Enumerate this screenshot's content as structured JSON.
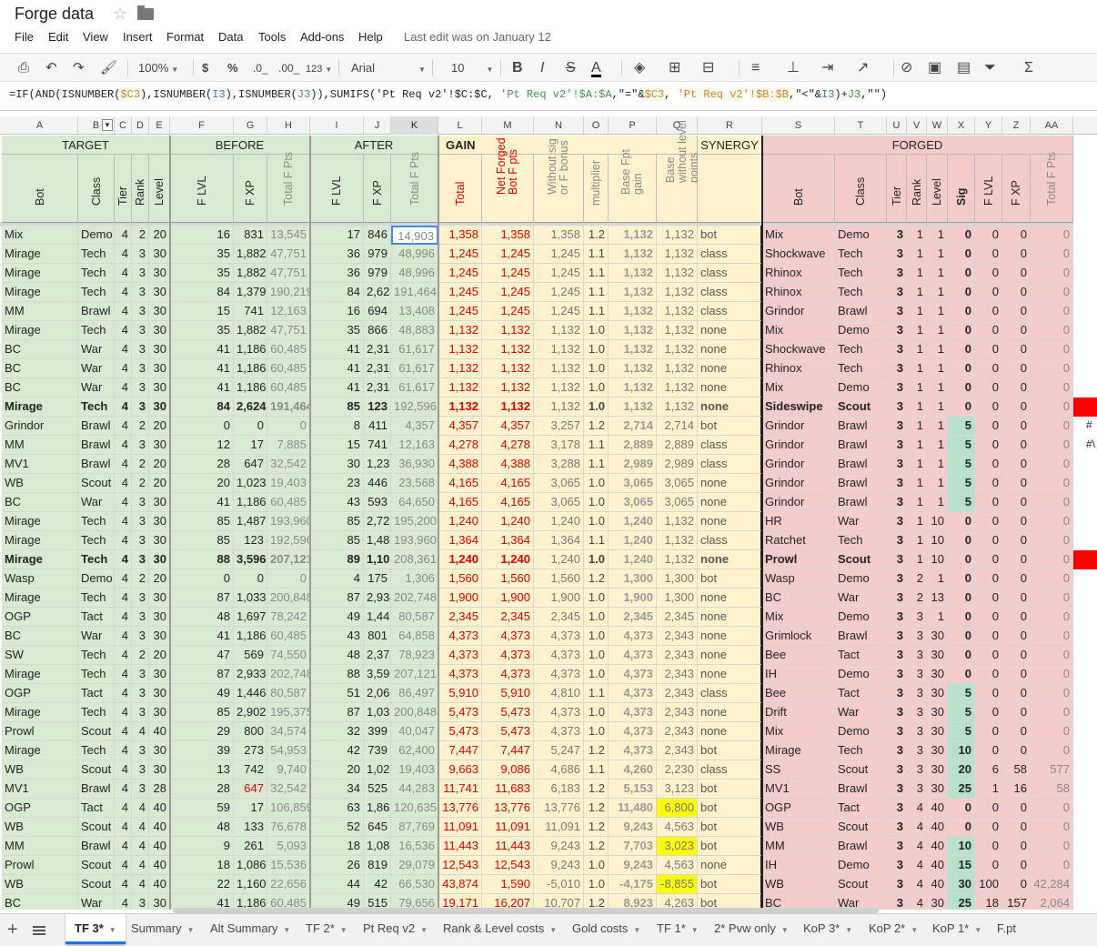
{
  "title": "Forge data",
  "menu": [
    "File",
    "Edit",
    "View",
    "Insert",
    "Format",
    "Data",
    "Tools",
    "Add-ons",
    "Help"
  ],
  "last_edit": "Last edit was on January 12",
  "toolbar": {
    "zoom": "100%",
    "currency": "$",
    "percent": "%",
    "dec_less": ".0_",
    "dec_more": ".00_",
    "format_num": "123",
    "font": "Arial",
    "size": "10"
  },
  "formula_parts": [
    {
      "t": "=IF(AND(ISNUMBER(",
      "c": ""
    },
    {
      "t": "$C3",
      "c": "f-ref1"
    },
    {
      "t": "),ISNUMBER(",
      "c": ""
    },
    {
      "t": "I3",
      "c": "f-ref2"
    },
    {
      "t": "),ISNUMBER(",
      "c": ""
    },
    {
      "t": "J3",
      "c": "f-ref3"
    },
    {
      "t": ")),SUMIFS('Pt Req v2'!$C:$C, ",
      "c": ""
    },
    {
      "t": "'Pt Req v2'!$A:$A",
      "c": "f-ref3"
    },
    {
      "t": ",\"=\"&",
      "c": ""
    },
    {
      "t": "$C3",
      "c": "f-ref1"
    },
    {
      "t": ", ",
      "c": ""
    },
    {
      "t": "'Pt Req v2'!$B:$B",
      "c": "f-num"
    },
    {
      "t": ",\"<\"&",
      "c": ""
    },
    {
      "t": "I3",
      "c": "f-ref2"
    },
    {
      "t": ")+",
      "c": ""
    },
    {
      "t": "J3",
      "c": "f-ref3"
    },
    {
      "t": ",\"\")",
      "c": ""
    }
  ],
  "columns": [
    "A",
    "B",
    "C",
    "D",
    "E",
    "F",
    "G",
    "H",
    "I",
    "J",
    "K",
    "L",
    "M",
    "N",
    "O",
    "P",
    "Q",
    "R",
    "S",
    "T",
    "U",
    "V",
    "W",
    "X",
    "Y",
    "Z",
    "AA"
  ],
  "bands": {
    "target": "TARGET",
    "before": "BEFORE",
    "after": "AFTER",
    "gain": "GAIN",
    "synergy": "SYNERGY",
    "forged": "FORGED"
  },
  "subheaders": [
    "Bot",
    "Class",
    "Tier",
    "Rank",
    "Level",
    "F LVL",
    "F XP",
    "Total F Pts",
    "F LVL",
    "F XP",
    "Total F Pts",
    "Total",
    "Net Forged Bot F pts",
    "Without sig or F bonus",
    "multiplier",
    "Base Fpt gain",
    "Base without level points",
    "",
    "Bot",
    "Class",
    "Tier",
    "Rank",
    "Level",
    "Sig",
    "F LVL",
    "F XP",
    "Total F Pts"
  ],
  "rows": [
    [
      "Mix",
      "Demo",
      "4",
      "2",
      "20",
      "16",
      "831",
      "13,545",
      "17",
      "846",
      "14,903",
      "1,358",
      "1,358",
      "1,358",
      "1.2",
      "1,132",
      "1,132",
      "bot",
      "Mix",
      "Demo",
      "3",
      "1",
      "1",
      "0",
      "0",
      "0",
      "0"
    ],
    [
      "Mirage",
      "Tech",
      "4",
      "3",
      "30",
      "35",
      "1,882",
      "47,751",
      "36",
      "979",
      "48,996",
      "1,245",
      "1,245",
      "1,245",
      "1.1",
      "1,132",
      "1,132",
      "class",
      "Shockwave",
      "Tech",
      "3",
      "1",
      "1",
      "0",
      "0",
      "0",
      "0"
    ],
    [
      "Mirage",
      "Tech",
      "4",
      "3",
      "30",
      "35",
      "1,882",
      "47,751",
      "36",
      "979",
      "48,996",
      "1,245",
      "1,245",
      "1,245",
      "1.1",
      "1,132",
      "1,132",
      "class",
      "Rhinox",
      "Tech",
      "3",
      "1",
      "1",
      "0",
      "0",
      "0",
      "0"
    ],
    [
      "Mirage",
      "Tech",
      "4",
      "3",
      "30",
      "84",
      "1,379",
      "190,219",
      "84",
      "2,624",
      "191,464",
      "1,245",
      "1,245",
      "1,245",
      "1.1",
      "1,132",
      "1,132",
      "class",
      "Rhinox",
      "Tech",
      "3",
      "1",
      "1",
      "0",
      "0",
      "0",
      "0"
    ],
    [
      "MM",
      "Brawl",
      "4",
      "3",
      "30",
      "15",
      "741",
      "12,163",
      "16",
      "694",
      "13,408",
      "1,245",
      "1,245",
      "1,245",
      "1.1",
      "1,132",
      "1,132",
      "class",
      "Grindor",
      "Brawl",
      "3",
      "1",
      "1",
      "0",
      "0",
      "0",
      "0"
    ],
    [
      "Mirage",
      "Tech",
      "4",
      "3",
      "30",
      "35",
      "1,882",
      "47,751",
      "35",
      "866",
      "48,883",
      "1,132",
      "1,132",
      "1,132",
      "1.0",
      "1,132",
      "1,132",
      "none",
      "Mix",
      "Demo",
      "3",
      "1",
      "1",
      "0",
      "0",
      "0",
      "0"
    ],
    [
      "BC",
      "War",
      "4",
      "3",
      "30",
      "41",
      "1,186",
      "60,485",
      "41",
      "2,318",
      "61,617",
      "1,132",
      "1,132",
      "1,132",
      "1.0",
      "1,132",
      "1,132",
      "none",
      "Shockwave",
      "Tech",
      "3",
      "1",
      "1",
      "0",
      "0",
      "0",
      "0"
    ],
    [
      "BC",
      "War",
      "4",
      "3",
      "30",
      "41",
      "1,186",
      "60,485",
      "41",
      "2,318",
      "61,617",
      "1,132",
      "1,132",
      "1,132",
      "1.0",
      "1,132",
      "1,132",
      "none",
      "Rhinox",
      "Tech",
      "3",
      "1",
      "1",
      "0",
      "0",
      "0",
      "0"
    ],
    [
      "BC",
      "War",
      "4",
      "3",
      "30",
      "41",
      "1,186",
      "60,485",
      "41",
      "2,318",
      "61,617",
      "1,132",
      "1,132",
      "1,132",
      "1.0",
      "1,132",
      "1,132",
      "none",
      "Mix",
      "Demo",
      "3",
      "1",
      "1",
      "0",
      "0",
      "0",
      "0"
    ],
    [
      "Mirage",
      "Tech",
      "4",
      "3",
      "30",
      "84",
      "2,624",
      "191,464",
      "85",
      "123",
      "192,596",
      "1,132",
      "1,132",
      "1,132",
      "1.0",
      "1,132",
      "1,132",
      "none",
      "Sideswipe",
      "Scout",
      "3",
      "1",
      "1",
      "0",
      "0",
      "0",
      "0"
    ],
    [
      "Grindor",
      "Brawl",
      "4",
      "2",
      "20",
      "0",
      "0",
      "0",
      "8",
      "411",
      "4,357",
      "4,357",
      "4,357",
      "3,257",
      "1.2",
      "2,714",
      "2,714",
      "bot",
      "Grindor",
      "Brawl",
      "3",
      "1",
      "1",
      "5",
      "0",
      "0",
      "0"
    ],
    [
      "MM",
      "Brawl",
      "4",
      "3",
      "30",
      "12",
      "17",
      "7,885",
      "15",
      "741",
      "12,163",
      "4,278",
      "4,278",
      "3,178",
      "1.1",
      "2,889",
      "2,889",
      "class",
      "Grindor",
      "Brawl",
      "3",
      "1",
      "1",
      "5",
      "0",
      "0",
      "0"
    ],
    [
      "MV1",
      "Brawl",
      "4",
      "2",
      "20",
      "28",
      "647",
      "32,542",
      "30",
      "1,237",
      "36,930",
      "4,388",
      "4,388",
      "3,288",
      "1.1",
      "2,989",
      "2,989",
      "class",
      "Grindor",
      "Brawl",
      "3",
      "1",
      "1",
      "5",
      "0",
      "0",
      "0"
    ],
    [
      "WB",
      "Scout",
      "4",
      "2",
      "20",
      "20",
      "1,023",
      "19,403",
      "23",
      "446",
      "23,568",
      "4,165",
      "4,165",
      "3,065",
      "1.0",
      "3,065",
      "3,065",
      "none",
      "Grindor",
      "Brawl",
      "3",
      "1",
      "1",
      "5",
      "0",
      "0",
      "0"
    ],
    [
      "BC",
      "War",
      "4",
      "3",
      "30",
      "41",
      "1,186",
      "60,485",
      "43",
      "593",
      "64,650",
      "4,165",
      "4,165",
      "3,065",
      "1.0",
      "3,065",
      "3,065",
      "none",
      "Grindor",
      "Brawl",
      "3",
      "1",
      "1",
      "5",
      "0",
      "0",
      "0"
    ],
    [
      "Mirage",
      "Tech",
      "4",
      "3",
      "30",
      "85",
      "1,487",
      "193,960",
      "85",
      "2,727",
      "195,200",
      "1,240",
      "1,240",
      "1,240",
      "1.0",
      "1,240",
      "1,132",
      "none",
      "HR",
      "War",
      "3",
      "1",
      "10",
      "0",
      "0",
      "0",
      "0"
    ],
    [
      "Mirage",
      "Tech",
      "4",
      "3",
      "30",
      "85",
      "123",
      "192,596",
      "85",
      "1,487",
      "193,960",
      "1,364",
      "1,364",
      "1,364",
      "1.1",
      "1,240",
      "1,132",
      "class",
      "Ratchet",
      "Tech",
      "3",
      "1",
      "10",
      "0",
      "0",
      "0",
      "0"
    ],
    [
      "Mirage",
      "Tech",
      "4",
      "3",
      "30",
      "88",
      "3,596",
      "207,121",
      "89",
      "1,101",
      "208,361",
      "1,240",
      "1,240",
      "1,240",
      "1.0",
      "1,240",
      "1,132",
      "none",
      "Prowl",
      "Scout",
      "3",
      "1",
      "10",
      "0",
      "0",
      "0",
      "0"
    ],
    [
      "Wasp",
      "Demo",
      "4",
      "2",
      "20",
      "0",
      "0",
      "0",
      "4",
      "175",
      "1,306",
      "1,560",
      "1,560",
      "1,560",
      "1.2",
      "1,300",
      "1,300",
      "bot",
      "Wasp",
      "Demo",
      "3",
      "2",
      "1",
      "0",
      "0",
      "0",
      "0"
    ],
    [
      "Mirage",
      "Tech",
      "4",
      "3",
      "30",
      "87",
      "1,033",
      "200,848",
      "87",
      "2,933",
      "202,748",
      "1,900",
      "1,900",
      "1,900",
      "1.0",
      "1,900",
      "1,300",
      "none",
      "BC",
      "War",
      "3",
      "2",
      "13",
      "0",
      "0",
      "0",
      "0"
    ],
    [
      "OGP",
      "Tact",
      "4",
      "3",
      "30",
      "48",
      "1,697",
      "78,242",
      "49",
      "1,446",
      "80,587",
      "2,345",
      "2,345",
      "2,345",
      "1.0",
      "2,345",
      "2,345",
      "none",
      "Mix",
      "Demo",
      "3",
      "3",
      "1",
      "0",
      "0",
      "0",
      "0"
    ],
    [
      "BC",
      "War",
      "4",
      "3",
      "30",
      "41",
      "1,186",
      "60,485",
      "43",
      "801",
      "64,858",
      "4,373",
      "4,373",
      "4,373",
      "1.0",
      "4,373",
      "2,343",
      "none",
      "Grimlock",
      "Brawl",
      "3",
      "3",
      "30",
      "0",
      "0",
      "0",
      "0"
    ],
    [
      "SW",
      "Tech",
      "4",
      "2",
      "20",
      "47",
      "569",
      "74,550",
      "48",
      "2,378",
      "78,923",
      "4,373",
      "4,373",
      "4,373",
      "1.0",
      "4,373",
      "2,343",
      "none",
      "Bee",
      "Tact",
      "3",
      "3",
      "30",
      "0",
      "0",
      "0",
      "0"
    ],
    [
      "Mirage",
      "Tech",
      "4",
      "3",
      "30",
      "87",
      "2,933",
      "202,748",
      "88",
      "3,596",
      "207,121",
      "4,373",
      "4,373",
      "4,373",
      "1.0",
      "4,373",
      "2,343",
      "none",
      "IH",
      "Demo",
      "3",
      "3",
      "30",
      "0",
      "0",
      "0",
      "0"
    ],
    [
      "OGP",
      "Tact",
      "4",
      "3",
      "30",
      "49",
      "1,446",
      "80,587",
      "51",
      "2,066",
      "86,497",
      "5,910",
      "5,910",
      "4,810",
      "1.1",
      "4,373",
      "2,343",
      "class",
      "Bee",
      "Tact",
      "3",
      "3",
      "30",
      "5",
      "0",
      "0",
      "0"
    ],
    [
      "Mirage",
      "Tech",
      "4",
      "3",
      "30",
      "85",
      "2,902",
      "195,375",
      "87",
      "1,033",
      "200,848",
      "5,473",
      "5,473",
      "4,373",
      "1.0",
      "4,373",
      "2,343",
      "none",
      "Drift",
      "War",
      "3",
      "3",
      "30",
      "5",
      "0",
      "0",
      "0"
    ],
    [
      "Prowl",
      "Scout",
      "4",
      "4",
      "40",
      "29",
      "800",
      "34,574",
      "32",
      "399",
      "40,047",
      "5,473",
      "5,473",
      "4,373",
      "1.0",
      "4,373",
      "2,343",
      "none",
      "Mix",
      "Demo",
      "3",
      "3",
      "30",
      "5",
      "0",
      "0",
      "0"
    ],
    [
      "Mirage",
      "Tech",
      "4",
      "3",
      "30",
      "39",
      "273",
      "54,953",
      "42",
      "739",
      "62,400",
      "7,447",
      "7,447",
      "5,247",
      "1.2",
      "4,373",
      "2,343",
      "bot",
      "Mirage",
      "Tech",
      "3",
      "3",
      "30",
      "10",
      "0",
      "0",
      "0"
    ],
    [
      "WB",
      "Scout",
      "4",
      "3",
      "30",
      "13",
      "742",
      "9,740",
      "20",
      "1,023",
      "19,403",
      "9,663",
      "9,086",
      "4,686",
      "1.1",
      "4,260",
      "2,230",
      "class",
      "SS",
      "Scout",
      "3",
      "3",
      "30",
      "20",
      "6",
      "58",
      "577"
    ],
    [
      "MV1",
      "Brawl",
      "4",
      "3",
      "28",
      "28",
      "647",
      "32,542",
      "34",
      "525",
      "44,283",
      "11,741",
      "11,683",
      "6,183",
      "1.2",
      "5,153",
      "3,123",
      "bot",
      "MV1",
      "Brawl",
      "3",
      "3",
      "30",
      "25",
      "1",
      "16",
      "58"
    ],
    [
      "OGP",
      "Tact",
      "4",
      "4",
      "40",
      "59",
      "17",
      "106,859",
      "63",
      "1,861",
      "120,635",
      "13,776",
      "13,776",
      "13,776",
      "1.2",
      "11,480",
      "6,800",
      "bot",
      "OGP",
      "Tact",
      "3",
      "4",
      "40",
      "0",
      "0",
      "0",
      "0"
    ],
    [
      "WB",
      "Scout",
      "4",
      "4",
      "40",
      "48",
      "133",
      "76,678",
      "52",
      "645",
      "87,769",
      "11,091",
      "11,091",
      "11,091",
      "1.2",
      "9,243",
      "4,563",
      "bot",
      "WB",
      "Scout",
      "3",
      "4",
      "40",
      "0",
      "0",
      "0",
      "0"
    ],
    [
      "MM",
      "Brawl",
      "4",
      "4",
      "40",
      "9",
      "261",
      "5,093",
      "18",
      "1,086",
      "16,536",
      "11,443",
      "11,443",
      "9,243",
      "1.2",
      "7,703",
      "3,023",
      "bot",
      "MM",
      "Brawl",
      "3",
      "4",
      "40",
      "10",
      "0",
      "0",
      "0"
    ],
    [
      "Prowl",
      "Scout",
      "4",
      "4",
      "40",
      "18",
      "1,086",
      "15,536",
      "26",
      "819",
      "29,079",
      "12,543",
      "12,543",
      "9,243",
      "1.0",
      "9,243",
      "4,563",
      "none",
      "IH",
      "Demo",
      "3",
      "4",
      "40",
      "15",
      "0",
      "0",
      "0"
    ],
    [
      "WB",
      "Scout",
      "4",
      "4",
      "40",
      "22",
      "1,160",
      "22,656",
      "44",
      "42",
      "66,530",
      "43,874",
      "1,590",
      "-5,010",
      "1.0",
      "-4,175",
      "-8,855",
      "bot",
      "WB",
      "Scout",
      "3",
      "4",
      "40",
      "30",
      "100",
      "0",
      "42,284"
    ],
    [
      "BC",
      "War",
      "4",
      "3",
      "30",
      "41",
      "1,186",
      "60,485",
      "49",
      "515",
      "79,656",
      "19,171",
      "16,207",
      "10,707",
      "1.2",
      "8,923",
      "4,263",
      "bot",
      "BC",
      "War",
      "3",
      "4",
      "30",
      "25",
      "18",
      "157",
      "2,064"
    ]
  ],
  "bold_rows": [
    9,
    17
  ],
  "red_g_rows": [
    29
  ],
  "yellow_q_rows": [
    30,
    32,
    34
  ],
  "green_x_rows": [
    10,
    11,
    12,
    13,
    14,
    24,
    25,
    26,
    27,
    28,
    29,
    32,
    33,
    34,
    35
  ],
  "overflow_text": {
    "10": "#",
    "11": "#\\"
  },
  "sheet_tabs": [
    "TF 3*",
    "Summary",
    "Alt Summary",
    "TF 2*",
    "Pt Req v2",
    "Rank & Level costs",
    "Gold costs",
    "TF 1*",
    "2* Pvw only",
    "KoP 3*",
    "KoP 2*",
    "KoP 1*",
    "F.pt requirements"
  ],
  "colors": {
    "target_bg": "#d9ead3",
    "gain_bg": "#fff2cc",
    "forged_bg": "#f4cccc",
    "red_text": "#e00000",
    "accent_red": "#ff0000",
    "highlight_yellow": "#ffff00",
    "sig_green": "#b7e1cd"
  }
}
